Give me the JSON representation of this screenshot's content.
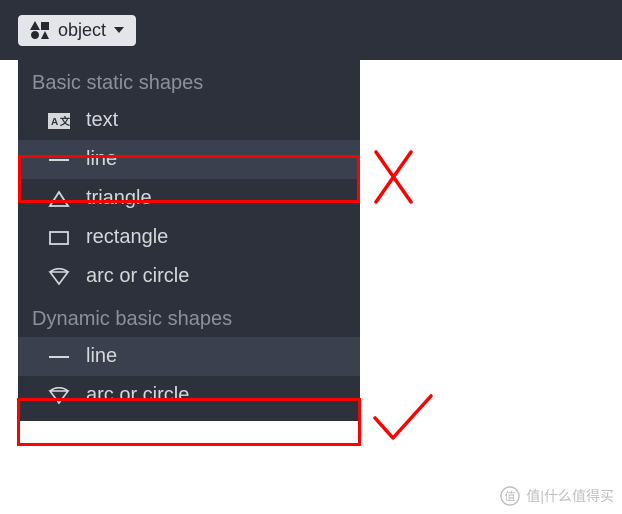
{
  "toolbar": {
    "object_button_label": "object"
  },
  "dropdown": {
    "section1": "Basic static shapes",
    "section2": "Dynamic basic shapes",
    "items_static": {
      "text": "text",
      "line": "line",
      "triangle": "triangle",
      "rectangle": "rectangle",
      "arc_or_circle": "arc or circle"
    },
    "items_dynamic": {
      "line": "line",
      "arc_or_circle": "arc or circle"
    }
  },
  "annotations": {
    "cross": "×",
    "check": "✓"
  },
  "watermark": {
    "text": "值|什么值得买"
  }
}
